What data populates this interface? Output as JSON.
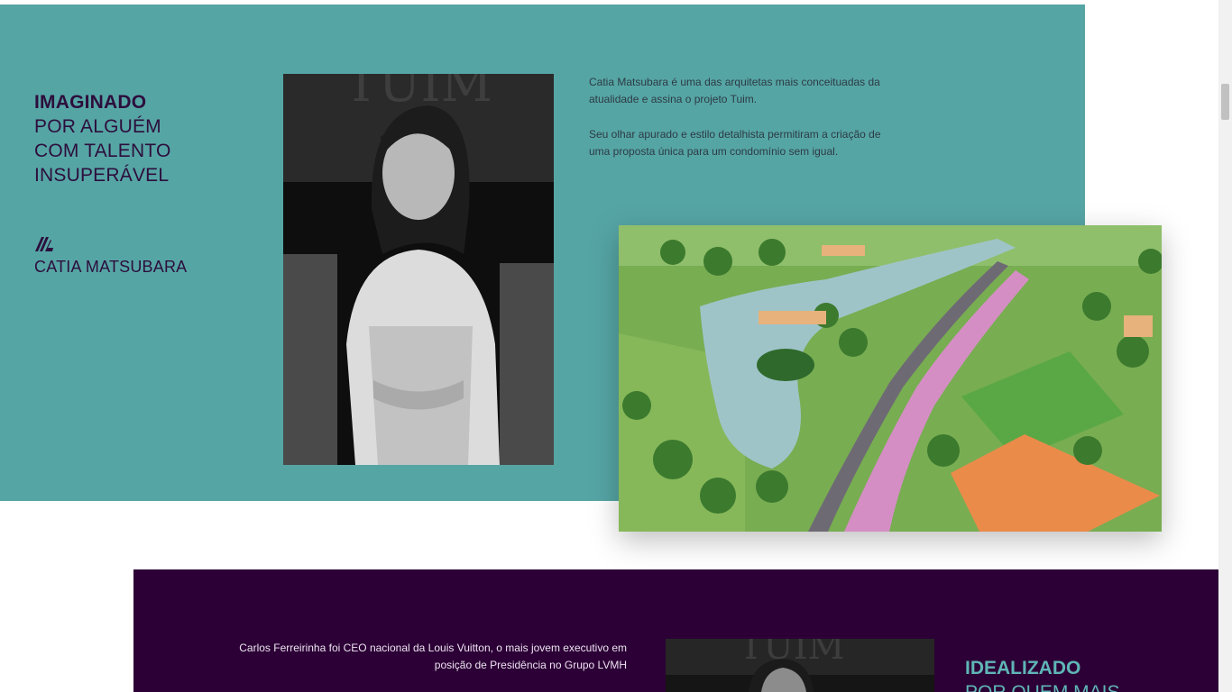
{
  "hero": {
    "heading_bold": "IMAGINADO",
    "heading_line1": "POR ALGUÉM",
    "heading_line2": "COM TALENTO",
    "heading_line3": "INSUPERÁVEL",
    "signature_icon": "cm-monogram-icon",
    "architect_name": "CATIA MATSUBARA",
    "paragraph1": "Catia Matsubara é uma das arquitetas mais conceituadas da atualidade e assina o projeto Tuim.",
    "paragraph2": "Seu olhar apurado e estilo detalhista permitiram a criação de uma proposta única para um condomínio sem igual.",
    "portrait_watermark": "TUIM"
  },
  "founder": {
    "bio": "Carlos Ferreirinha foi CEO nacional da Louis Vuitton, o mais jovem executivo em posição de Presidência no Grupo LVMH",
    "heading_bold": "IDEALIZADO",
    "heading_line1": "POR QUEM MAIS",
    "portrait_watermark": "TUIM"
  },
  "colors": {
    "teal": "#56a5a5",
    "purple": "#2c0036",
    "heading_dark": "#2c0e3c",
    "heading_teal": "#5fb6b6"
  }
}
